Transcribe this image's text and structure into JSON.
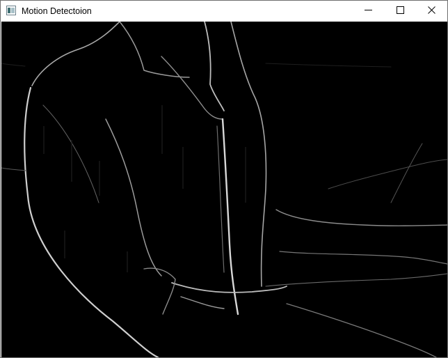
{
  "window": {
    "title": "Motion Detectoion",
    "icon": "app-window-icon",
    "controls": {
      "minimize": "minimize-icon",
      "maximize": "maximize-icon",
      "close": "close-icon"
    }
  },
  "frame": {
    "description_icon": "edge-detected-video-frame",
    "background": "#000000",
    "edge_color": "#bdbdbd"
  }
}
